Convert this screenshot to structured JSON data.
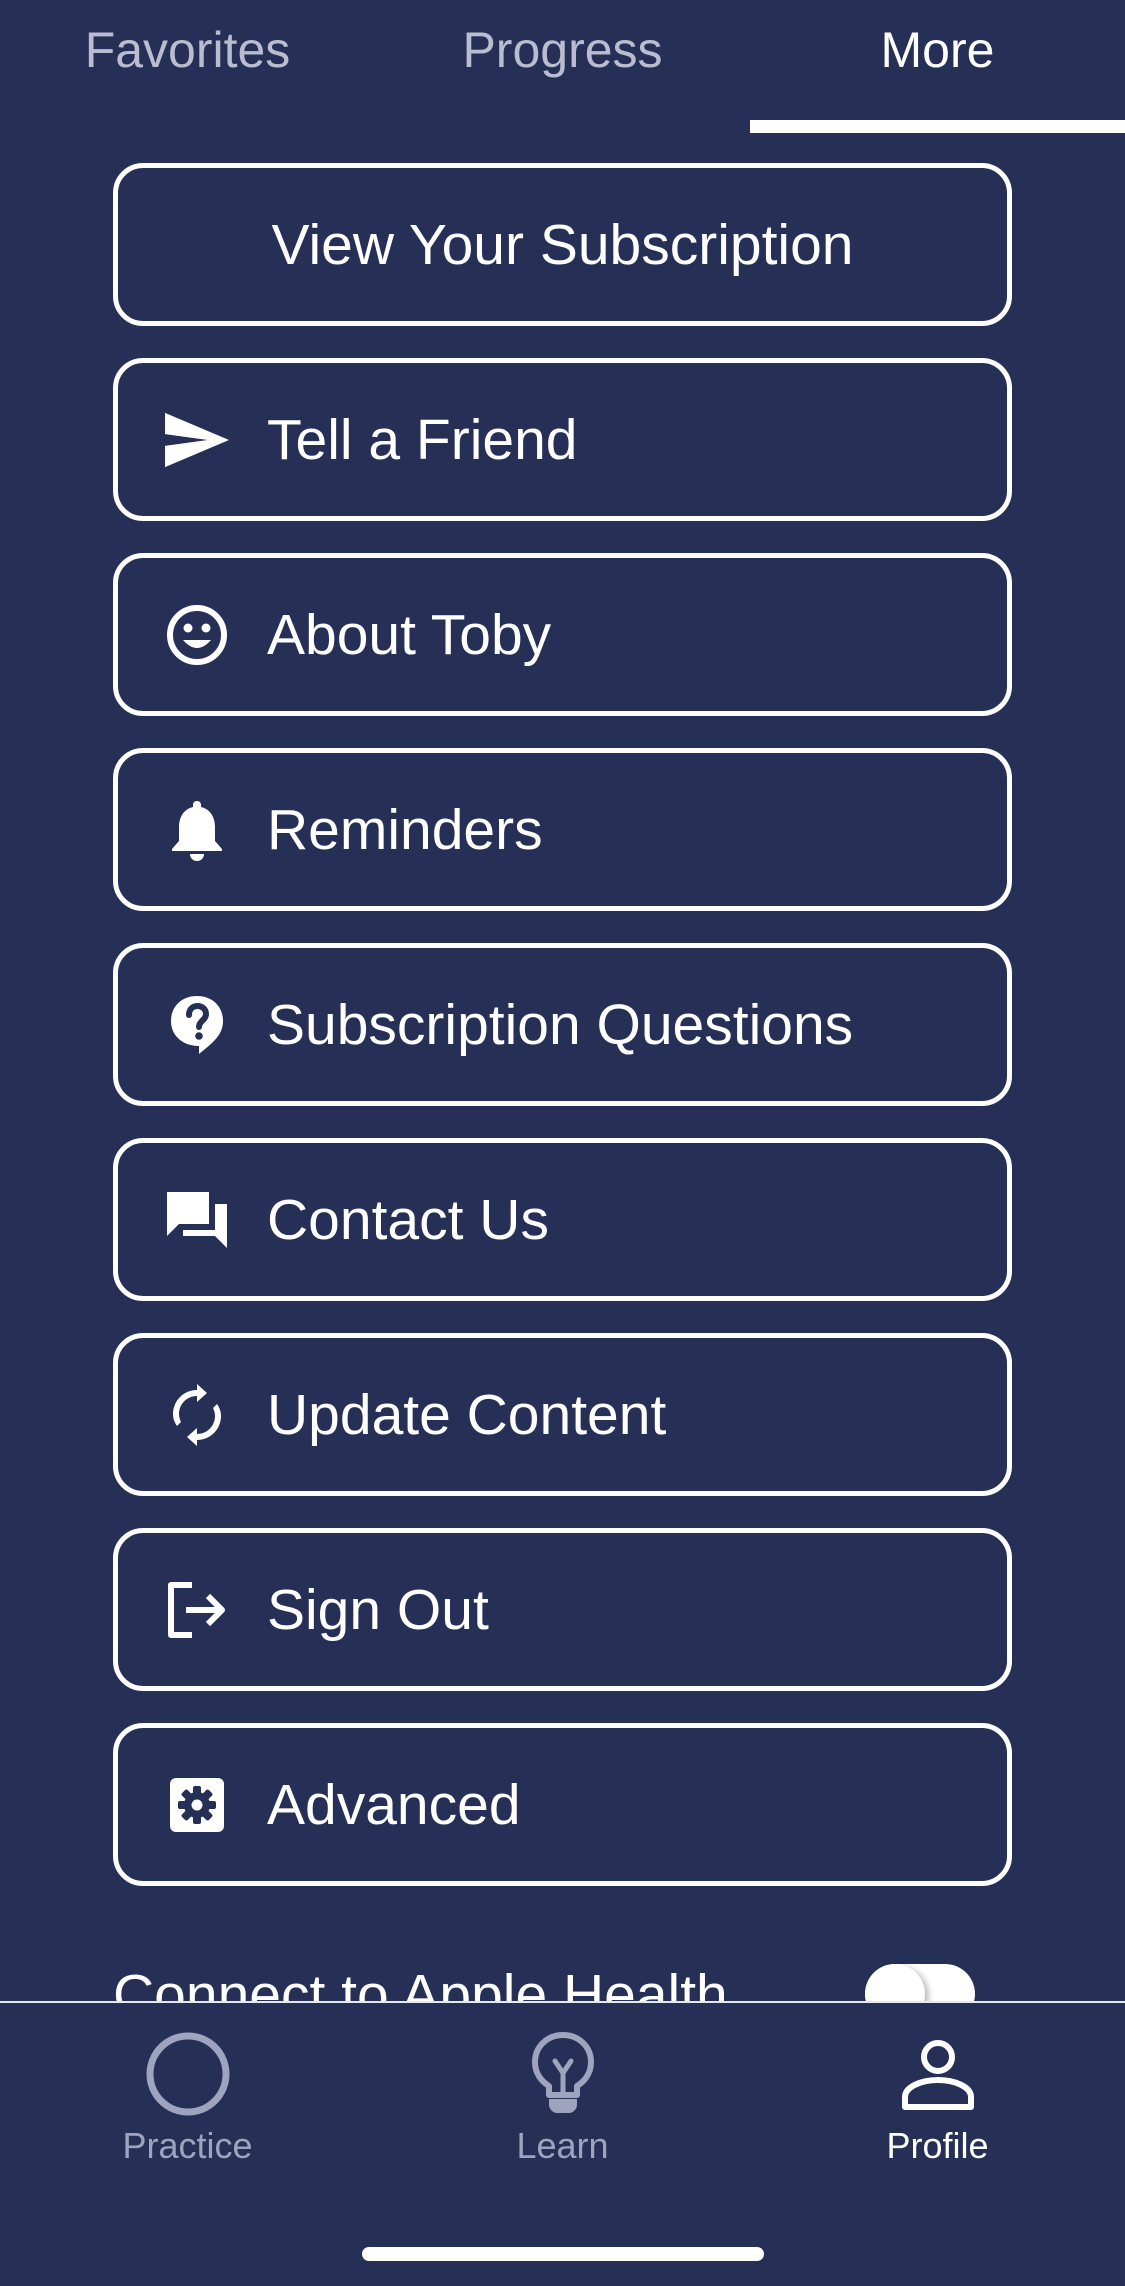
{
  "top_tabs": [
    {
      "label": "Favorites",
      "active": false
    },
    {
      "label": "Progress",
      "active": false
    },
    {
      "label": "More",
      "active": true
    }
  ],
  "menu": {
    "subscription": {
      "label": "View Your Subscription"
    },
    "tell_friend": {
      "label": "Tell a Friend",
      "icon": "send-icon"
    },
    "about": {
      "label": "About Toby",
      "icon": "smiley-icon"
    },
    "reminders": {
      "label": "Reminders",
      "icon": "bell-icon"
    },
    "questions": {
      "label": "Subscription Questions",
      "icon": "help-icon"
    },
    "contact": {
      "label": "Contact Us",
      "icon": "chat-icon"
    },
    "update": {
      "label": "Update Content",
      "icon": "sync-icon"
    },
    "signout": {
      "label": "Sign Out",
      "icon": "logout-icon"
    },
    "advanced": {
      "label": "Advanced",
      "icon": "gear-icon"
    }
  },
  "health": {
    "label": "Connect to Apple Health",
    "enabled": true
  },
  "bottom_nav": [
    {
      "label": "Practice",
      "icon": "circle-icon",
      "active": false
    },
    {
      "label": "Learn",
      "icon": "lightbulb-icon",
      "active": false
    },
    {
      "label": "Profile",
      "icon": "person-icon",
      "active": true
    }
  ],
  "colors": {
    "background": "#262f56",
    "foreground": "#ffffff",
    "inactive": "#9ea4bd"
  }
}
